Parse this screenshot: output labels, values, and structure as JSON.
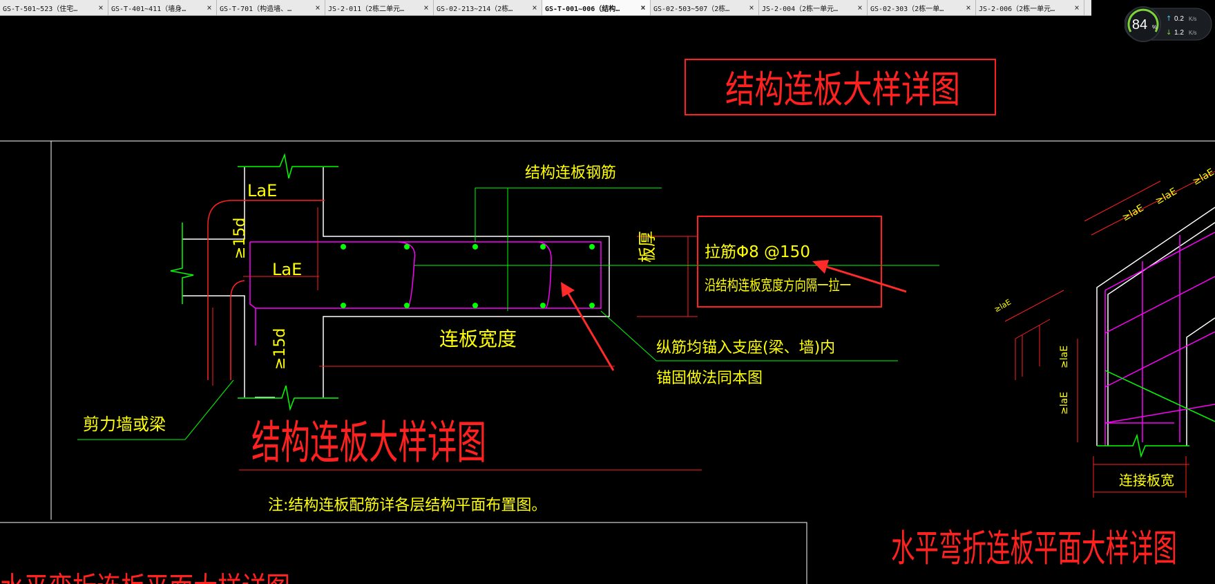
{
  "tabs": [
    {
      "label": "GS-T-501~523（住宅…",
      "active": false
    },
    {
      "label": "GS-T-401~411（墙身…",
      "active": false
    },
    {
      "label": "GS-T-701（构造墙、…",
      "active": false
    },
    {
      "label": "JS-2-011（2栋二单元…",
      "active": false
    },
    {
      "label": "GS-02-213~214（2栋…",
      "active": false
    },
    {
      "label": "GS-T-001~006（结构…",
      "active": true
    },
    {
      "label": "GS-02-503~507（2栋…",
      "active": false
    },
    {
      "label": "JS-2-004（2栋一单元…",
      "active": false
    },
    {
      "label": "GS-02-303（2栋一单…",
      "active": false
    },
    {
      "label": "JS-2-006（2栋一单元…",
      "active": false
    }
  ],
  "tab_close_glyph": "×",
  "net_widget": {
    "percent": "84",
    "percent_unit": "%",
    "upload": "0.2",
    "download": "1.2",
    "unit": "K/s"
  },
  "drawing": {
    "title_top": "结构连板大样详图",
    "label_lae_1": "LaE",
    "label_lae_2": "LaE",
    "label_15d_1": "≥15d",
    "label_15d_2": "≥15d",
    "label_rebar": "结构连板钢筋",
    "label_tie": "拉筋Φ8 @150",
    "label_tie_note": "沿结构连板宽度方向隔一拉一",
    "label_thickness": "板厚",
    "label_width": "连板宽度",
    "label_anchor_1": "纵筋均锚入支座(梁、墙)内",
    "label_anchor_2": "锚固做法同本图",
    "label_wall": "剪力墙或梁",
    "title_main": "结构连板大样详图",
    "note": "注:结构连板配筋详各层结构平面布置图。",
    "label_right_lae_a": "≥laE",
    "label_right_lae_b": "≥laE",
    "label_right_lae_c": "≥laE",
    "label_right_lae_d": "≥laE",
    "label_right_lae_e": "≥laE",
    "label_right_lae_f": "≥laE",
    "label_conn_width": "连接板宽",
    "title_right": "水平弯折连板平面大样详图",
    "title_bottom_partial": "水平弯折连板平面大样详图"
  },
  "colors": {
    "background": "#000000",
    "red": "#ff2020",
    "yellow": "#ffff00",
    "green": "#00ff00",
    "magenta": "#ff00ff",
    "white": "#ffffff",
    "annotation_arrow": "#ff2a2a"
  }
}
